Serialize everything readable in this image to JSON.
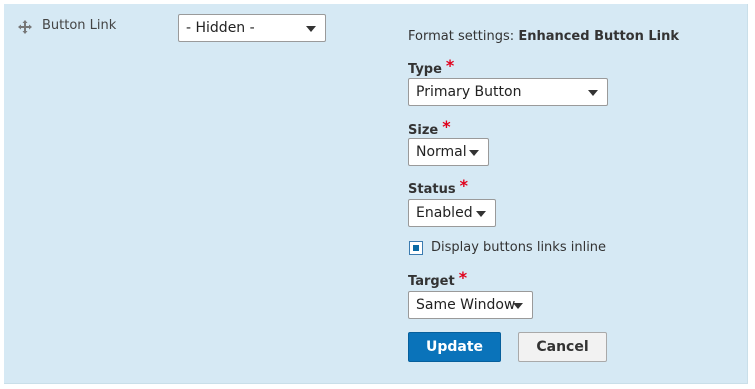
{
  "field": {
    "label": "Button Link",
    "visibility_value": "- Hidden -"
  },
  "format_settings": {
    "prefix": "Format settings:",
    "formatter_name": "Enhanced Button Link",
    "required_marker": "*",
    "type": {
      "label": "Type",
      "value": "Primary Button"
    },
    "size": {
      "label": "Size",
      "value": "Normal"
    },
    "status": {
      "label": "Status",
      "value": "Enabled"
    },
    "inline_checkbox": {
      "label": "Display buttons links inline",
      "checked": true
    },
    "target": {
      "label": "Target",
      "value": "Same Window"
    }
  },
  "actions": {
    "update_label": "Update",
    "cancel_label": "Cancel"
  },
  "colors": {
    "row_background": "#d6e9f4",
    "primary_button": "#0a73ba",
    "required": "#e0001b"
  },
  "icons": {
    "drag": "move-arrows-icon",
    "dropdown": "chevron-down-icon"
  }
}
